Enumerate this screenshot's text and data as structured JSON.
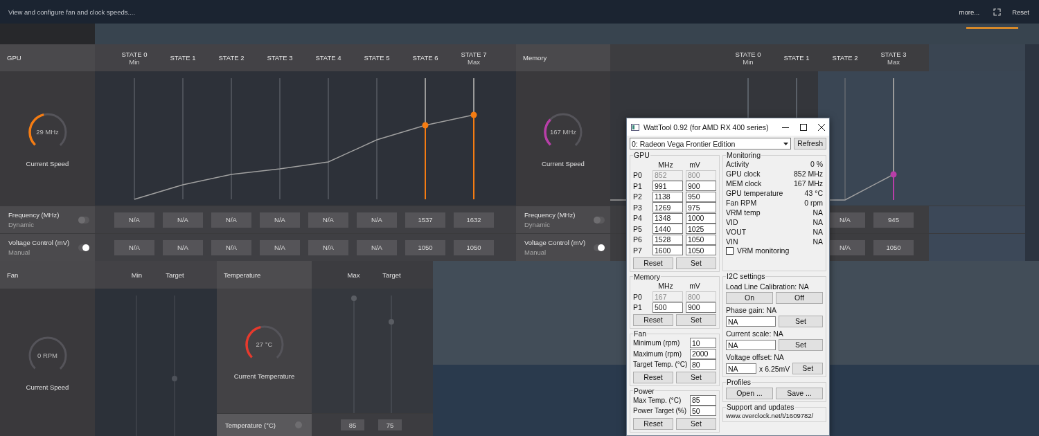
{
  "header": {
    "description": "View and configure fan and clock speeds....",
    "more": "more...",
    "reset": "Reset"
  },
  "gpu": {
    "title": "GPU",
    "gauge": {
      "value": "29 MHz",
      "label": "Current Speed",
      "level": 0.45
    },
    "states": [
      {
        "label": "STATE 0",
        "sublabel": "Min",
        "highlighted": false
      },
      {
        "label": "STATE 1",
        "highlighted": false
      },
      {
        "label": "STATE 2",
        "highlighted": false
      },
      {
        "label": "STATE 3",
        "highlighted": false
      },
      {
        "label": "STATE 4",
        "highlighted": false
      },
      {
        "label": "STATE 5",
        "highlighted": false
      },
      {
        "label": "STATE 6",
        "highlighted": true
      },
      {
        "label": "STATE 7",
        "sublabel": "Max",
        "highlighted": true
      }
    ],
    "rows": [
      {
        "label": "Frequency (MHz)",
        "mode": "Dynamic",
        "on": false,
        "values": [
          "N/A",
          "N/A",
          "N/A",
          "N/A",
          "N/A",
          "N/A",
          "1537",
          "1632"
        ]
      },
      {
        "label": "Voltage Control (mV)",
        "mode": "Manual",
        "on": true,
        "values": [
          "N/A",
          "N/A",
          "N/A",
          "N/A",
          "N/A",
          "N/A",
          "1050",
          "1050"
        ]
      }
    ]
  },
  "memory": {
    "title": "Memory",
    "gauge": {
      "value": "167 MHz",
      "label": "Current Speed",
      "level": 0.33
    },
    "states": [
      {
        "label": "STATE 0",
        "sublabel": "Min",
        "highlighted": false
      },
      {
        "label": "STATE 1",
        "highlighted": false
      },
      {
        "label": "STATE 2",
        "highlighted": false
      },
      {
        "label": "STATE 3",
        "sublabel": "Max",
        "highlighted": true
      }
    ],
    "rows": [
      {
        "label": "Frequency (MHz)",
        "mode": "Dynamic",
        "on": false,
        "values": [
          "N/A",
          "945"
        ]
      },
      {
        "label": "Voltage Control (mV)",
        "mode": "Manual",
        "on": true,
        "values": [
          "N/A",
          "1050"
        ]
      }
    ]
  },
  "fan": {
    "title": "Fan",
    "columns": [
      "Min",
      "Target"
    ],
    "gauge": {
      "value": "0 RPM",
      "label": "Current Speed",
      "level": 0
    }
  },
  "temperature": {
    "title": "Temperature",
    "columns": [
      "Max",
      "Target"
    ],
    "gauge": {
      "value": "27 °C",
      "label": "Current Temperature",
      "level": 0.45
    },
    "row": {
      "label": "Temperature (°C)",
      "on": false,
      "values": [
        "85",
        "75"
      ]
    }
  },
  "watttool": {
    "title": "WattTool 0.92 (for AMD RX 400 series)",
    "device": "0: Radeon Vega Frontier Edition",
    "refresh": "Refresh",
    "gpu": {
      "title": "GPU",
      "columns": [
        "MHz",
        "mV"
      ],
      "rows": [
        {
          "label": "P0",
          "mhz": "852",
          "mv": "800",
          "disabled": true
        },
        {
          "label": "P1",
          "mhz": "991",
          "mv": "900",
          "disabled": false
        },
        {
          "label": "P2",
          "mhz": "1138",
          "mv": "950",
          "disabled": false
        },
        {
          "label": "P3",
          "mhz": "1269",
          "mv": "975",
          "disabled": false
        },
        {
          "label": "P4",
          "mhz": "1348",
          "mv": "1000",
          "disabled": false
        },
        {
          "label": "P5",
          "mhz": "1440",
          "mv": "1025",
          "disabled": false
        },
        {
          "label": "P6",
          "mhz": "1528",
          "mv": "1050",
          "disabled": false
        },
        {
          "label": "P7",
          "mhz": "1600",
          "mv": "1050",
          "disabled": false
        }
      ],
      "buttons": [
        "Reset",
        "Set"
      ]
    },
    "memory": {
      "title": "Memory",
      "columns": [
        "MHz",
        "mV"
      ],
      "rows": [
        {
          "label": "P0",
          "mhz": "167",
          "mv": "800",
          "disabled": true
        },
        {
          "label": "P1",
          "mhz": "500",
          "mv": "900",
          "disabled": false
        }
      ],
      "buttons": [
        "Reset",
        "Set"
      ]
    },
    "fan": {
      "title": "Fan",
      "fields": [
        {
          "label": "Minimum (rpm)",
          "value": "10"
        },
        {
          "label": "Maximum (rpm)",
          "value": "2000"
        },
        {
          "label": "Target Temp. (°C)",
          "value": "80"
        }
      ],
      "buttons": [
        "Reset",
        "Set"
      ]
    },
    "power": {
      "title": "Power",
      "fields": [
        {
          "label": "Max Temp. (°C)",
          "value": "85"
        },
        {
          "label": "Power Target (%)",
          "value": "50"
        }
      ],
      "buttons": [
        "Reset",
        "Set"
      ]
    },
    "monitoring": {
      "title": "Monitoring",
      "items": [
        {
          "label": "Activity",
          "value": "0 %"
        },
        {
          "label": "GPU clock",
          "value": "852 MHz"
        },
        {
          "label": "MEM clock",
          "value": "167 MHz"
        },
        {
          "label": "GPU temperature",
          "value": "43 °C"
        },
        {
          "label": "Fan RPM",
          "value": "0 rpm"
        },
        {
          "label": "VRM temp",
          "value": "NA"
        },
        {
          "label": "VID",
          "value": "NA"
        },
        {
          "label": "VOUT",
          "value": "NA"
        },
        {
          "label": "VIN",
          "value": "NA"
        }
      ],
      "checkbox": {
        "label": "VRM monitoring",
        "checked": false
      }
    },
    "i2c": {
      "title": "I2C settings",
      "llc": {
        "label": "Load Line Calibration: NA",
        "buttons": [
          "On",
          "Off"
        ]
      },
      "settings": [
        {
          "label": "Phase gain: NA",
          "value": "NA",
          "button": "Set"
        },
        {
          "label": "Current scale: NA",
          "value": "NA",
          "button": "Set"
        },
        {
          "label": "Voltage offset: NA",
          "value": "NA",
          "unit": "x 6.25mV",
          "button": "Set"
        }
      ]
    },
    "profiles": {
      "title": "Profiles",
      "buttons": [
        "Open ...",
        "Save ..."
      ]
    },
    "support": {
      "title": "Support and updates",
      "link": "www.overclock.net/t/1609782/"
    }
  }
}
